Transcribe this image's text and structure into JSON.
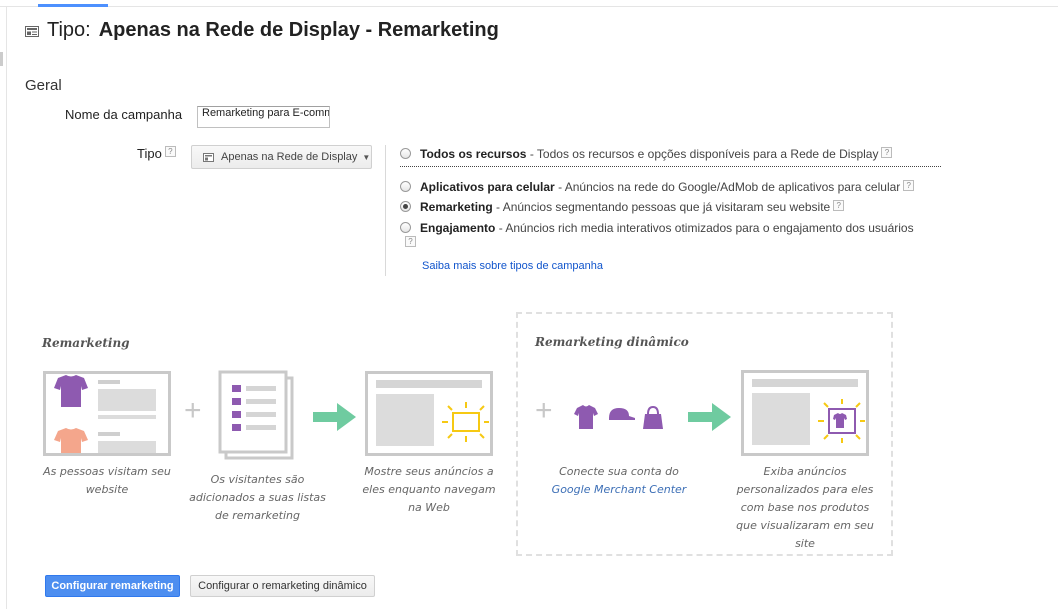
{
  "header": {
    "prefix": "Tipo:",
    "title": "Apenas na Rede de Display - Remarketing"
  },
  "section": "Geral",
  "form": {
    "nome_label": "Nome da campanha",
    "nome_value": "Remarketing para E-commerce",
    "tipo_label": "Tipo",
    "tipo_value": "Apenas na Rede de Display",
    "help_glyph": "?"
  },
  "options": [
    {
      "title": "Todos os recursos",
      "desc": " - Todos os recursos e opções disponíveis para a Rede de Display",
      "selected": false
    },
    {
      "title": "Aplicativos para celular",
      "desc": " - Anúncios na rede do Google/AdMob de aplicativos para celular",
      "selected": false
    },
    {
      "title": "Remarketing",
      "desc": " - Anúncios segmentando pessoas que já visitaram seu website",
      "selected": true
    },
    {
      "title": "Engajamento",
      "desc": " - Anúncios rich media interativos otimizados para o engajamento dos usuários",
      "selected": false
    }
  ],
  "learn_more": "Saiba mais sobre tipos de campanha",
  "illustration": {
    "remarketing_title": "Remarketing",
    "dynamic_title": "Remarketing dinâmico",
    "captions": {
      "step1": "As pessoas visitam seu website",
      "step2": "Os visitantes são adicionados a suas listas de remarketing",
      "step3": "Mostre seus anúncios a eles enquanto navegam na Web",
      "step4_pre": "Conecte sua conta do",
      "step4_link": "Google Merchant Center",
      "step5": "Exiba anúncios personalizados para eles com base nos produtos que visualizaram em seu site"
    },
    "plus": "+"
  },
  "buttons": {
    "primary": "Configurar remarketing",
    "secondary": "Configurar o remarketing dinâmico"
  },
  "colors": {
    "accent_blue": "#4d8ef0",
    "link": "#1155cc",
    "purple": "#8e5ab0",
    "peach": "#f4a68c",
    "arrow_green": "#6fcba0",
    "sun_yellow": "#f6c913"
  }
}
